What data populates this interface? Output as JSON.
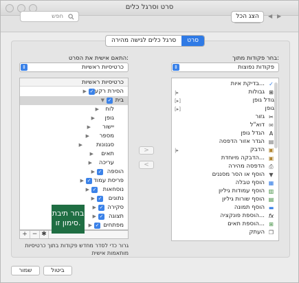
{
  "window": {
    "title": "סרט וסרגל כלים"
  },
  "toolbar": {
    "show_all_label": "הצג הכל",
    "search_placeholder": "חפש"
  },
  "tabs": [
    {
      "label": "סרט",
      "selected": true
    },
    {
      "label": "סרגל כלים לגישה מהירה",
      "selected": false
    }
  ],
  "left_pane": {
    "label": "בחר פקודות מתוך:",
    "dropdown_value": "פקודות נפוצות",
    "commands": [
      "בדיקת איות...",
      "גבולות",
      "גודל גופן",
      "גופן",
      "גזור",
      "דוא\"ל",
      "הגדל גופן",
      "הגדר אזור הדפסה",
      "הדבק",
      "הדבקה מיוחדת...",
      "הדפסה מהירה",
      "הוסף או הסר מסננים",
      "הוסף טבלה",
      "הוסף עמודות גיליון",
      "הוסף שורות גיליון",
      "הוסף תמונה",
      "הוספת פונקציה...",
      "הוספת תאים...",
      "העתק"
    ]
  },
  "right_pane": {
    "label": "התאם אישית את הסרט:",
    "dropdown_value": "כרטיסיות ראשיות",
    "header": "כרטיסיות ראשיות",
    "tabs_list": [
      {
        "label": "הסירת רקע",
        "checked": true,
        "level": 0
      },
      {
        "label": "בית",
        "checked": true,
        "level": 0,
        "expanded": true
      },
      {
        "label": "לוח",
        "level": 1
      },
      {
        "label": "גופן",
        "level": 1
      },
      {
        "label": "יישור",
        "level": 1
      },
      {
        "label": "מספר",
        "level": 1
      },
      {
        "label": "סגנונות",
        "level": 1
      },
      {
        "label": "תאים",
        "level": 1
      },
      {
        "label": "עריכה",
        "level": 1
      },
      {
        "label": "הוספה",
        "checked": true,
        "level": 0
      },
      {
        "label": "פריסת עמוד",
        "checked": true,
        "level": 0
      },
      {
        "label": "נוסחאות",
        "checked": true,
        "level": 0
      },
      {
        "label": "נתונים",
        "checked": true,
        "level": 0
      },
      {
        "label": "סקירה",
        "checked": true,
        "level": 0
      },
      {
        "label": "תצוגה",
        "checked": true,
        "level": 0
      },
      {
        "label": "מפתחים",
        "checked": true,
        "level": 0
      }
    ],
    "add_symbol": "+",
    "remove_symbol": "−",
    "settings_symbol": "✱"
  },
  "hint_text": "גרור כדי לסדר מחדש פקודות בתוך כרטיסיות\nמותאמות אישית",
  "callout_text": "בחר תיבת סימון זו.",
  "footer": {
    "save_label": "שמור",
    "cancel_label": "ביטול"
  },
  "move_right_symbol": ">",
  "move_left_symbol": "<",
  "colors": {
    "accent": "#3b82e8",
    "callout": "#1f6e43"
  }
}
